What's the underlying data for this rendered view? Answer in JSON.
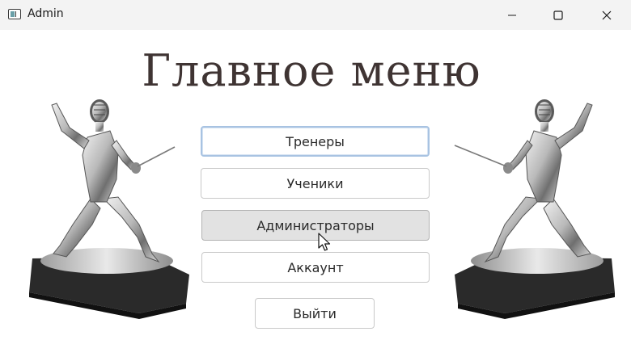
{
  "window": {
    "title": "Admin",
    "icons": [
      "app-window-icon",
      "minimize-icon",
      "maximize-icon",
      "close-icon"
    ]
  },
  "main": {
    "heading": "Главное меню",
    "buttons": {
      "trainers": "Тренеры",
      "students": "Ученики",
      "admins": "Администраторы",
      "account": "Аккаунт",
      "exit": "Выйти"
    },
    "images": [
      "fencer-statue-left",
      "fencer-statue-right"
    ]
  },
  "colors": {
    "heading": "#3f3433",
    "focused_border": "#a8c3e2",
    "hover_background": "#e2e2e2",
    "titlebar": "#f3f3f3"
  }
}
